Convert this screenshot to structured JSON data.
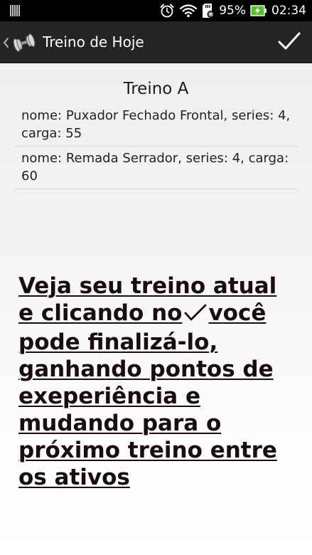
{
  "status_bar": {
    "battery_percent": "95%",
    "time": "02:34",
    "icons": [
      "signal-bars-icon",
      "alarm-clock-icon",
      "wifi-icon",
      "sd-card-icon",
      "battery-charging-icon"
    ]
  },
  "action_bar": {
    "title": "Treino de Hoje",
    "icons": [
      "chevron-left-icon",
      "dumbbell-icon",
      "checkmark-icon"
    ]
  },
  "workout": {
    "title": "Treino A",
    "exercises": [
      {
        "text": "nome: Puxador Fechado Frontal, series: 4, carga: 55"
      },
      {
        "text": "nome: Remada Serrador, series: 4, carga: 60"
      }
    ]
  },
  "tip": {
    "before": "Veja seu treino atual e clicando no",
    "after": "você pode finalizá-lo, ganhando pontos de exeperiência e mudando para o próximo treino entre os ativos"
  },
  "colors": {
    "status_bar": "#000000",
    "action_bar": "#242424",
    "battery_green": "#5bbd2b",
    "tip_text": "#1a0d0d"
  }
}
